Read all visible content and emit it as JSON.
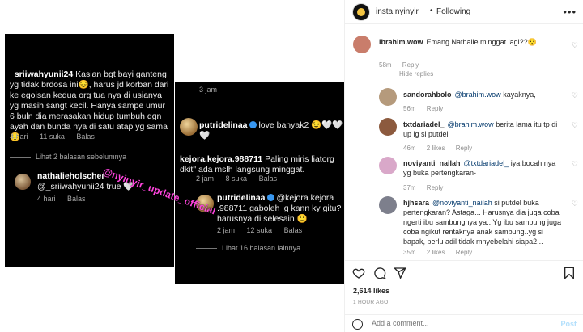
{
  "post": {
    "owner": "insta.nyinyir",
    "separator": "•",
    "follow_state": "Following",
    "likes": "2,614 likes",
    "time_ago": "1 HOUR AGO",
    "comment_placeholder": "Add a comment...",
    "post_label": "Post",
    "more_icon": "•••"
  },
  "image": {
    "shot1": {
      "c1_user": "_sriiwahyunii24",
      "c1_text": "Kasian bgt bayi ganteng yg tidak brdosa ini😔, harus jd korban dari ke egoisan kedua org tua nya di usianya yg masih sangt kecil. Hanya sampe umur 6 buln dia merasakan hidup tumbuh dgn ayah dan bunda nya di satu atap yg sama😔",
      "c1_time": "4 hari",
      "c1_likes": "11 suka",
      "c1_reply": "Balas",
      "view_replies": "Lihat 2 balasan sebelumnya",
      "c2_user": "nathalieholscher",
      "c2_text": "@_sriiwahyunii24 true 🤍",
      "c2_time": "4 hari",
      "c2_reply": "Balas"
    },
    "shot2": {
      "top_time": "3 jam",
      "c1_user": "putridelinaa",
      "c1_text": "love banyak2 😉🤍🤍🤍",
      "c2_user": "kejora.kejora.988711",
      "c2_text": "Paling miris liatorg dkit\" ada mslh langsung minggat.",
      "c2_time": "2 jam",
      "c2_likes": "8 suka",
      "c2_reply": "Balas",
      "c3_user": "putridelinaa",
      "c3_text": "@kejora.kejora .988711 gaboleh jg kann ky gitu? harusnya di selesain 🙂",
      "c3_time": "2 jam",
      "c3_likes": "12 suka",
      "c3_reply": "Balas",
      "more_replies": "Lihat 16 balasan lainnya"
    },
    "watermark": "@nyinyir_update_official"
  },
  "comments": {
    "hide_replies": "Hide replies",
    "reply_label": "Reply",
    "items": [
      {
        "user": "ibrahim.wow",
        "text": "Emang Nathalie minggat lagi??😯",
        "mention": "",
        "time": "58m",
        "likes": "",
        "avatar_color": "#c97d6b"
      },
      {
        "user": "sandorahbolo",
        "mention": "@brahim.wow",
        "text": "kayaknya,",
        "time": "56m",
        "likes": "",
        "avatar_color": "#b59a7c"
      },
      {
        "user": "txtdariadel_",
        "mention": "@brahim.wow",
        "text": "berita lama itu tp di up lg si putdel",
        "time": "46m",
        "likes": "2 likes",
        "avatar_color": "#8c5a3e"
      },
      {
        "user": "noviyanti_nailah",
        "mention": "@txtdariadel_",
        "text": "iya bocah nya yg buka pertengkaran-",
        "time": "37m",
        "likes": "",
        "avatar_color": "#d9a8c9"
      },
      {
        "user": "hjhsara",
        "mention": "@noviyanti_nailah",
        "text": "si putdel buka pertengkaran? Astaga... Harusnya dia juga coba ngerti ibu sambungnya ya.. Yg ibu sambung juga coba ngikut rentaknya anak sambung..yg si bapak, perlu adil tidak mnyebelahi siapa2...",
        "time": "35m",
        "likes": "2 likes",
        "avatar_color": "#7d7f8c"
      }
    ]
  },
  "icons": {
    "heart": "heart-icon",
    "comment": "comment-icon",
    "share": "share-icon",
    "save": "bookmark-icon",
    "emoji": "emoji-icon"
  }
}
